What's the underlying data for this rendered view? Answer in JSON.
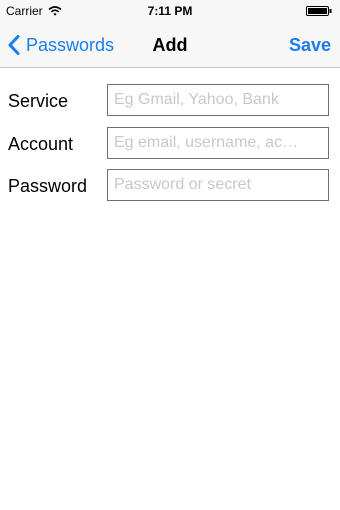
{
  "status_bar": {
    "carrier": "Carrier",
    "time": "7:11 PM",
    "wifi_icon": "wifi-icon",
    "battery_icon": "battery-icon"
  },
  "nav": {
    "back_label": "Passwords",
    "back_icon": "chevron-left-icon",
    "title": "Add",
    "save_label": "Save",
    "accent_color": "#1a7df0"
  },
  "form": {
    "service": {
      "label": "Service",
      "value": "",
      "placeholder": "Eg Gmail, Yahoo, Bank"
    },
    "account": {
      "label": "Account",
      "value": "",
      "placeholder": "Eg email, username, ac…"
    },
    "password": {
      "label": "Password",
      "value": "",
      "placeholder": "Password or secret"
    }
  }
}
